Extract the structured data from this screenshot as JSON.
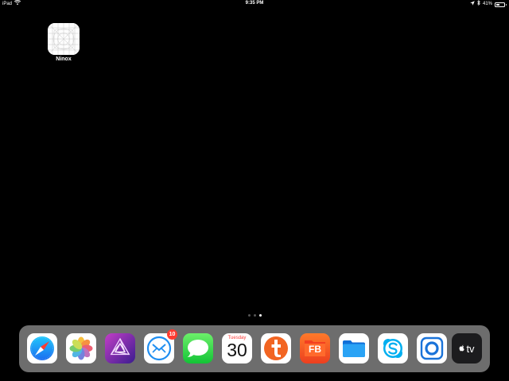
{
  "status_bar": {
    "device": "iPad",
    "time": "9:35 PM",
    "battery_percent": "41%",
    "battery_level": 0.41,
    "icons": [
      "wifi-icon",
      "location-arrow-icon",
      "bluetooth-icon",
      "battery-icon"
    ]
  },
  "home_apps": [
    {
      "label": "Ninox",
      "icon": "ninox-icon"
    }
  ],
  "page_indicator": {
    "pages": 3,
    "current": 3
  },
  "dock": {
    "apps": [
      {
        "icon": "safari-icon"
      },
      {
        "icon": "photos-icon"
      },
      {
        "icon": "affinity-photo-icon"
      },
      {
        "icon": "airmail-icon",
        "badge": "10"
      },
      {
        "icon": "messages-icon"
      },
      {
        "icon": "calendar-icon",
        "day": "Tuesday",
        "date": "30"
      },
      {
        "icon": "tinder-icon"
      },
      {
        "icon": "fb-app-icon",
        "text": "FB"
      },
      {
        "icon": "files-icon"
      },
      {
        "icon": "skype-icon"
      },
      {
        "icon": "teamviewer-icon"
      },
      {
        "icon": "apple-tv-icon",
        "text": "tv"
      }
    ]
  },
  "colors": {
    "background": "#000000",
    "dock": "#6d6d6d",
    "badge": "#ff3b30",
    "calendar_red": "#fc3d39"
  }
}
